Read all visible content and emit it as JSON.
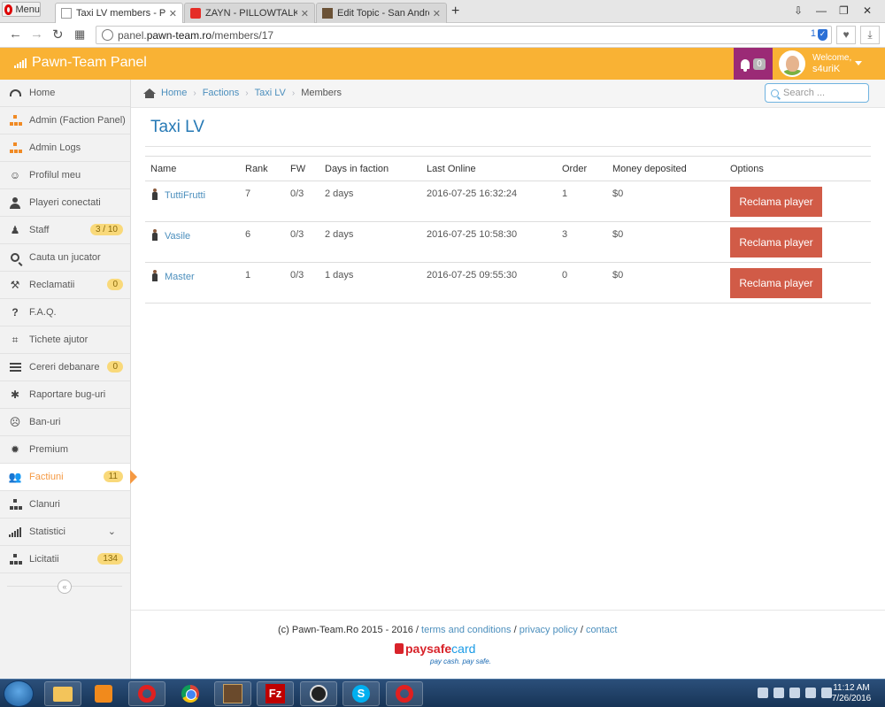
{
  "browser": {
    "menu_label": "Menu",
    "tabs": [
      {
        "label": "Taxi LV members - Pawn-T",
        "active": true
      },
      {
        "label": "ZAYN - PILLOWTALK (Bea",
        "active": false
      },
      {
        "label": "Edit Topic - San Andreas M",
        "active": false
      }
    ],
    "new_tab": "+",
    "url_prefix": "panel.",
    "url_host": "pawn-team.ro",
    "url_path": "/members/17",
    "adblock_count": "1"
  },
  "header": {
    "brand": "Pawn-Team Panel",
    "notif_count": "0",
    "welcome": "Welcome,",
    "username": "s4uriK"
  },
  "sidebar": {
    "items": [
      {
        "label": "Home",
        "icon": "dashboard-icon"
      },
      {
        "label": "Admin (Faction Panel)",
        "icon": "sitemap-icon"
      },
      {
        "label": "Admin Logs",
        "icon": "sitemap-icon"
      },
      {
        "label": "Profilul meu",
        "icon": "smile-icon"
      },
      {
        "label": "Playeri conectati",
        "icon": "user-icon"
      },
      {
        "label": "Staff",
        "icon": "android-icon",
        "badge": "3 / 10"
      },
      {
        "label": "Cauta un jucator",
        "icon": "search-icon"
      },
      {
        "label": "Reclamatii",
        "icon": "gavel-icon",
        "badge": "0"
      },
      {
        "label": "F.A.Q.",
        "icon": "question-icon"
      },
      {
        "label": "Tichete ajutor",
        "icon": "ticket-icon"
      },
      {
        "label": "Cereri debanare",
        "icon": "list-icon",
        "badge": "0"
      },
      {
        "label": "Raportare bug-uri",
        "icon": "bug-icon"
      },
      {
        "label": "Ban-uri",
        "icon": "frown-icon"
      },
      {
        "label": "Premium",
        "icon": "gear-icon"
      },
      {
        "label": "Factiuni",
        "icon": "users-icon",
        "badge": "11",
        "active": true
      },
      {
        "label": "Clanuri",
        "icon": "sitemap-icon"
      },
      {
        "label": "Statistici",
        "icon": "signal-icon",
        "has_chevron": true
      },
      {
        "label": "Licitatii",
        "icon": "sitemap-icon",
        "badge": "134"
      }
    ],
    "collapse_symbol": "«"
  },
  "breadcrumb": {
    "home": "Home",
    "factions": "Factions",
    "faction": "Taxi LV",
    "current": "Members",
    "sep": "›"
  },
  "search": {
    "placeholder": "Search ..."
  },
  "page": {
    "title": "Taxi LV"
  },
  "table": {
    "columns": [
      "Name",
      "Rank",
      "FW",
      "Days in faction",
      "Last Online",
      "Order",
      "Money deposited",
      "Options"
    ],
    "rows": [
      {
        "name": "TuttiFrutti",
        "rank": "7",
        "fw": "0/3",
        "days": "2 days",
        "last_online": "2016-07-25 16:32:24",
        "order": "1",
        "money": "$0",
        "action": "Reclama player"
      },
      {
        "name": "Vasile",
        "rank": "6",
        "fw": "0/3",
        "days": "2 days",
        "last_online": "2016-07-25 10:58:30",
        "order": "3",
        "money": "$0",
        "action": "Reclama player"
      },
      {
        "name": "Master",
        "rank": "1",
        "fw": "0/3",
        "days": "1 days",
        "last_online": "2016-07-25 09:55:30",
        "order": "0",
        "money": "$0",
        "action": "Reclama player"
      }
    ]
  },
  "footer": {
    "copyright": "(c) Pawn-Team.Ro 2015 - 2016 /",
    "terms": "terms and conditions",
    "sep": "/",
    "privacy": "privacy policy",
    "contact": "contact",
    "paysafe_1": "paysafe",
    "paysafe_2": "card",
    "paysafe_tagline": "pay cash. pay safe."
  },
  "taskbar": {
    "time": "11:12 AM",
    "date": "7/26/2016"
  },
  "colors": {
    "header": "#f9b234",
    "notif_bg": "#9b2a76",
    "link": "#4c8fbd",
    "title": "#2679b5",
    "button": "#d15b47",
    "active_sidebar": "#f59942"
  }
}
